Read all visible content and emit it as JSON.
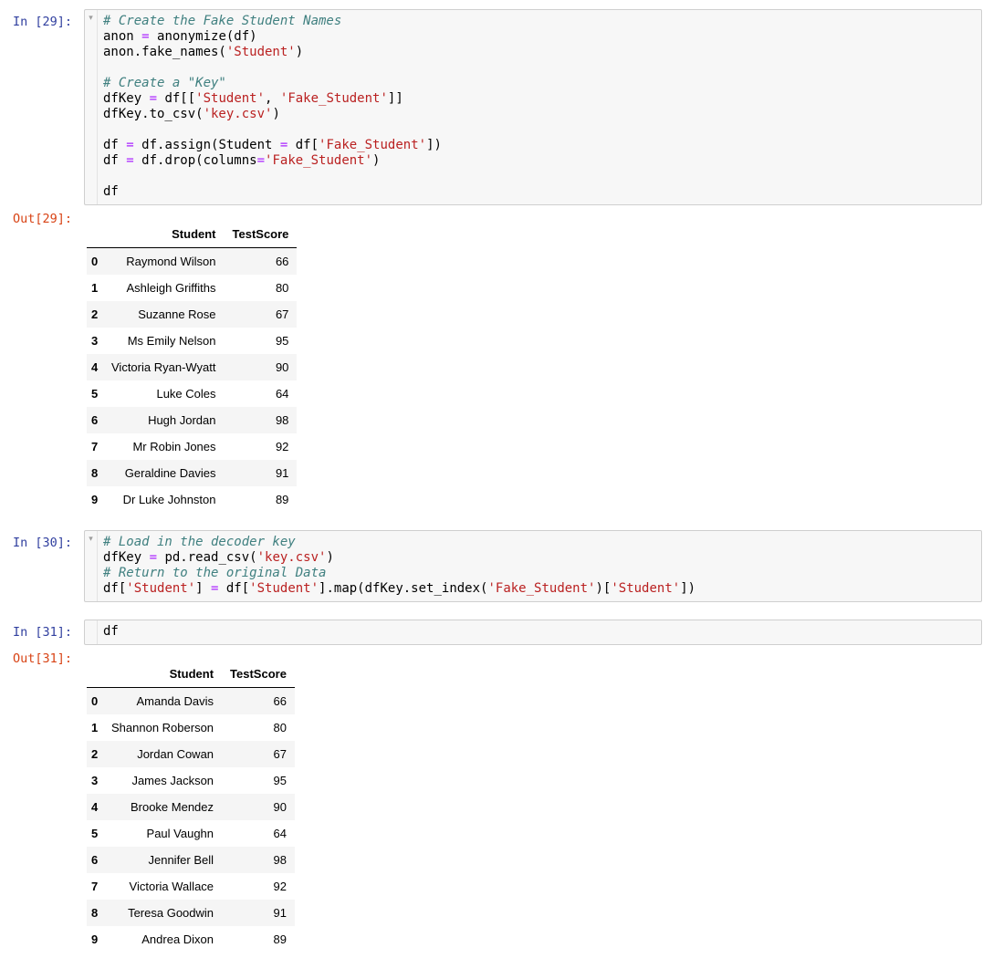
{
  "colors": {
    "input_prompt": "#303F9F",
    "output_prompt": "#D84315",
    "cell_bg": "#F7F7F7",
    "cell_border": "#CFCFCF",
    "comment": "#408080",
    "operator": "#AA22FF",
    "string": "#BA2121",
    "code_text": "#000000",
    "stripe": "#F5F5F5",
    "header_border": "#000000"
  },
  "notebook": {
    "cells": [
      {
        "prompt_in": "In [29]:",
        "fold_arrow": "▾",
        "has_fold_arrow": true,
        "code_lines": [
          [
            {
              "text": "# Create the Fake Student Names",
              "style": "comment"
            }
          ],
          [
            {
              "text": "anon ",
              "style": "plain"
            },
            {
              "text": "=",
              "style": "operator"
            },
            {
              "text": " anonymize(df)",
              "style": "plain"
            }
          ],
          [
            {
              "text": "anon.fake_names(",
              "style": "plain"
            },
            {
              "text": "'Student'",
              "style": "string"
            },
            {
              "text": ")",
              "style": "plain"
            }
          ],
          [],
          [
            {
              "text": "# Create a \"Key\"",
              "style": "comment"
            }
          ],
          [
            {
              "text": "dfKey ",
              "style": "plain"
            },
            {
              "text": "=",
              "style": "operator"
            },
            {
              "text": " df[[",
              "style": "plain"
            },
            {
              "text": "'Student'",
              "style": "string"
            },
            {
              "text": ", ",
              "style": "plain"
            },
            {
              "text": "'Fake_Student'",
              "style": "string"
            },
            {
              "text": "]]",
              "style": "plain"
            }
          ],
          [
            {
              "text": "dfKey.to_csv(",
              "style": "plain"
            },
            {
              "text": "'key.csv'",
              "style": "string"
            },
            {
              "text": ")",
              "style": "plain"
            }
          ],
          [],
          [
            {
              "text": "df ",
              "style": "plain"
            },
            {
              "text": "=",
              "style": "operator"
            },
            {
              "text": " df.assign(Student ",
              "style": "plain"
            },
            {
              "text": "=",
              "style": "operator"
            },
            {
              "text": " df[",
              "style": "plain"
            },
            {
              "text": "'Fake_Student'",
              "style": "string"
            },
            {
              "text": "])",
              "style": "plain"
            }
          ],
          [
            {
              "text": "df ",
              "style": "plain"
            },
            {
              "text": "=",
              "style": "operator"
            },
            {
              "text": " df.drop(columns",
              "style": "plain"
            },
            {
              "text": "=",
              "style": "operator"
            },
            {
              "text": "'Fake_Student'",
              "style": "string"
            },
            {
              "text": ")",
              "style": "plain"
            }
          ],
          [],
          [
            {
              "text": "df",
              "style": "plain"
            }
          ]
        ],
        "output": {
          "prompt_out": "Out[29]:",
          "table": {
            "columns": [
              "Student",
              "TestScore"
            ],
            "rows": [
              [
                "0",
                "Raymond Wilson",
                "66"
              ],
              [
                "1",
                "Ashleigh Griffiths",
                "80"
              ],
              [
                "2",
                "Suzanne Rose",
                "67"
              ],
              [
                "3",
                "Ms Emily Nelson",
                "95"
              ],
              [
                "4",
                "Victoria Ryan-Wyatt",
                "90"
              ],
              [
                "5",
                "Luke Coles",
                "64"
              ],
              [
                "6",
                "Hugh Jordan",
                "98"
              ],
              [
                "7",
                "Mr Robin Jones",
                "92"
              ],
              [
                "8",
                "Geraldine Davies",
                "91"
              ],
              [
                "9",
                "Dr Luke Johnston",
                "89"
              ]
            ]
          }
        }
      },
      {
        "prompt_in": "In [30]:",
        "fold_arrow": "▾",
        "has_fold_arrow": true,
        "code_lines": [
          [
            {
              "text": "# Load in the decoder key",
              "style": "comment"
            }
          ],
          [
            {
              "text": "dfKey ",
              "style": "plain"
            },
            {
              "text": "=",
              "style": "operator"
            },
            {
              "text": " pd.read_csv(",
              "style": "plain"
            },
            {
              "text": "'key.csv'",
              "style": "string"
            },
            {
              "text": ")",
              "style": "plain"
            }
          ],
          [
            {
              "text": "# Return to the original Data",
              "style": "comment"
            }
          ],
          [
            {
              "text": "df[",
              "style": "plain"
            },
            {
              "text": "'Student'",
              "style": "string"
            },
            {
              "text": "] ",
              "style": "plain"
            },
            {
              "text": "=",
              "style": "operator"
            },
            {
              "text": " df[",
              "style": "plain"
            },
            {
              "text": "'Student'",
              "style": "string"
            },
            {
              "text": "].map(dfKey.set_index(",
              "style": "plain"
            },
            {
              "text": "'Fake_Student'",
              "style": "string"
            },
            {
              "text": ")[",
              "style": "plain"
            },
            {
              "text": "'Student'",
              "style": "string"
            },
            {
              "text": "])",
              "style": "plain"
            }
          ]
        ],
        "output": null
      },
      {
        "prompt_in": "In [31]:",
        "fold_arrow": "",
        "has_fold_arrow": false,
        "code_lines": [
          [
            {
              "text": "df",
              "style": "plain"
            }
          ]
        ],
        "output": {
          "prompt_out": "Out[31]:",
          "table": {
            "columns": [
              "Student",
              "TestScore"
            ],
            "rows": [
              [
                "0",
                "Amanda Davis",
                "66"
              ],
              [
                "1",
                "Shannon Roberson",
                "80"
              ],
              [
                "2",
                "Jordan Cowan",
                "67"
              ],
              [
                "3",
                "James Jackson",
                "95"
              ],
              [
                "4",
                "Brooke Mendez",
                "90"
              ],
              [
                "5",
                "Paul Vaughn",
                "64"
              ],
              [
                "6",
                "Jennifer Bell",
                "98"
              ],
              [
                "7",
                "Victoria Wallace",
                "92"
              ],
              [
                "8",
                "Teresa Goodwin",
                "91"
              ],
              [
                "9",
                "Andrea Dixon",
                "89"
              ]
            ]
          }
        }
      }
    ]
  }
}
